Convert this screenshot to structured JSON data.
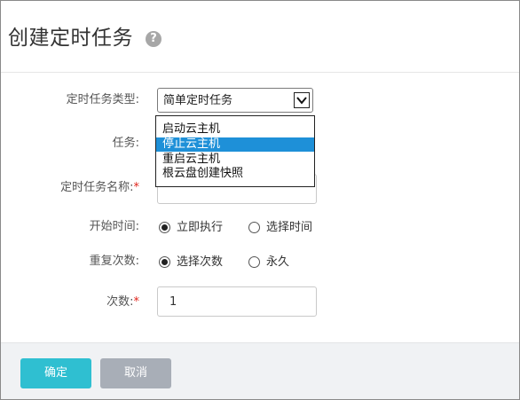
{
  "dialog": {
    "title": "创建定时任务",
    "help_icon": "question-circle-icon"
  },
  "form": {
    "task_type": {
      "label": "定时任务类型:",
      "selected": "简单定时任务"
    },
    "task": {
      "label": "任务:",
      "options": [
        "启动云主机",
        "停止云主机",
        "重启云主机",
        "根云盘创建快照"
      ],
      "highlighted_index": 1
    },
    "task_name": {
      "label": "定时任务名称:",
      "required_mark": "*",
      "value": ""
    },
    "start_time": {
      "label": "开始时间:",
      "options": [
        "立即执行",
        "选择时间"
      ],
      "checked": "立即执行"
    },
    "repeat": {
      "label": "重复次数:",
      "options": [
        "选择次数",
        "永久"
      ],
      "checked": "选择次数"
    },
    "count": {
      "label": "次数:",
      "required_mark": "*",
      "value": "1"
    }
  },
  "footer": {
    "confirm_label": "确定",
    "cancel_label": "取消"
  },
  "colors": {
    "primary_button": "#2fbfd1",
    "cancel_button": "#a8aeb7",
    "selection_highlight": "#1e90d8",
    "required": "#e0241b"
  }
}
